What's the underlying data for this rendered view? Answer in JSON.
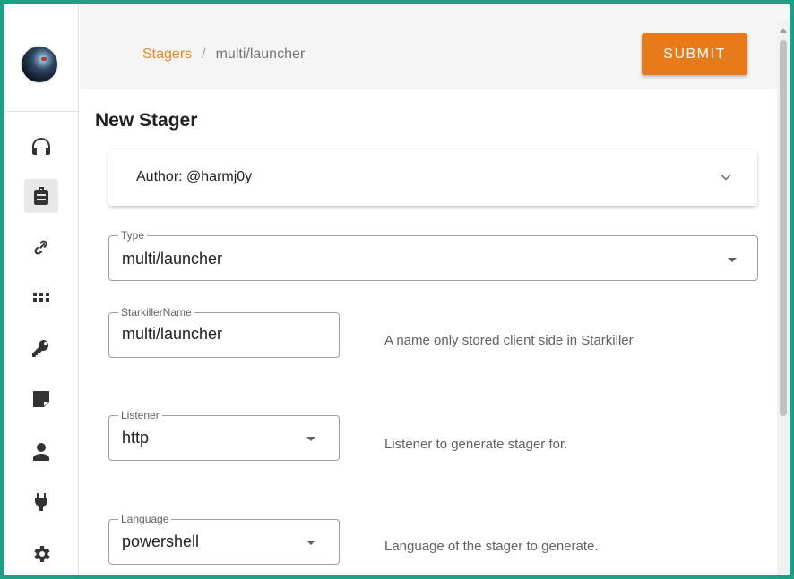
{
  "sidebar": {
    "items": [
      {
        "icon": "headphones-icon"
      },
      {
        "icon": "briefcase-icon",
        "active": true
      },
      {
        "icon": "link-icon"
      },
      {
        "icon": "grid-icon"
      },
      {
        "icon": "key-icon"
      },
      {
        "icon": "note-icon"
      },
      {
        "icon": "user-icon"
      },
      {
        "icon": "plug-icon"
      },
      {
        "icon": "gear-icon"
      }
    ]
  },
  "header": {
    "breadcrumb": {
      "link": "Stagers",
      "separator": "/",
      "current": "multi/launcher"
    },
    "submit_label": "SUBMIT"
  },
  "main": {
    "title": "New Stager",
    "author_panel": {
      "text": "Author: @harmj0y"
    },
    "fields": {
      "type": {
        "label": "Type",
        "value": "multi/launcher"
      },
      "name": {
        "label": "StarkillerName",
        "value": "multi/launcher",
        "hint": "A name only stored client side in Starkiller"
      },
      "listener": {
        "label": "Listener",
        "value": "http",
        "hint": "Listener to generate stager for."
      },
      "language": {
        "label": "Language",
        "value": "powershell",
        "hint": "Language of the stager to generate."
      }
    }
  },
  "colors": {
    "accent": "#e77a1a",
    "frame": "#1e9e82",
    "breadcrumb_link": "#e5892b"
  }
}
